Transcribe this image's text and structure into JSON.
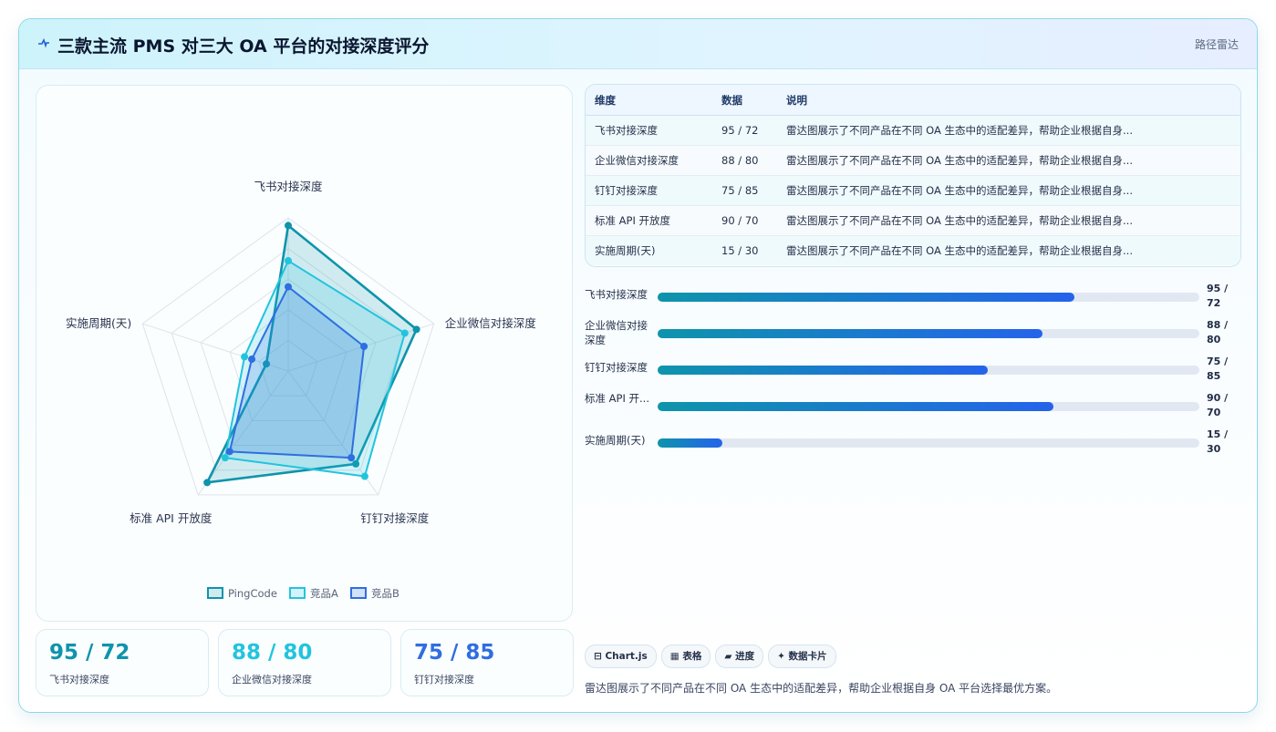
{
  "header": {
    "icon": "pulse-icon",
    "title": "三款主流 PMS 对三大 OA 平台的对接深度评分",
    "tag": "路径雷达"
  },
  "colors": {
    "PingCode": "#0e94ab",
    "competitor_a": "#22c4dd",
    "competitor_b": "#2f6ee0",
    "accent": "#2563eb"
  },
  "chart_data": {
    "type": "radar",
    "axes": [
      "飞书对接深度",
      "企业微信对接深度",
      "钉钉对接深度",
      "标准 API 开放度",
      "实施周期(天)"
    ],
    "series": [
      {
        "name": "PingCode",
        "values": [
          95,
          88,
          75,
          90,
          15
        ]
      },
      {
        "name": "竞品A",
        "values": [
          72,
          80,
          85,
          70,
          30
        ]
      },
      {
        "name": "竞品B",
        "values": [
          55,
          52,
          70,
          65,
          25
        ]
      }
    ],
    "range": [
      0,
      100
    ],
    "rings": 5,
    "legend_position": "bottom"
  },
  "stats": [
    {
      "value": "95 / 72",
      "label": "飞书对接深度"
    },
    {
      "value": "88 / 80",
      "label": "企业微信对接深度"
    },
    {
      "value": "75 / 85",
      "label": "钉钉对接深度"
    }
  ],
  "table": {
    "headers": [
      "维度",
      "数据",
      "说明"
    ],
    "rows": [
      [
        "飞书对接深度",
        "95 / 72",
        "雷达图展示了不同产品在不同 OA 生态中的适配差异，帮助企业根据自身..."
      ],
      [
        "企业微信对接深度",
        "88 / 80",
        "雷达图展示了不同产品在不同 OA 生态中的适配差异，帮助企业根据自身..."
      ],
      [
        "钉钉对接深度",
        "75 / 85",
        "雷达图展示了不同产品在不同 OA 生态中的适配差异，帮助企业根据自身..."
      ],
      [
        "标准 API 开放度",
        "90 / 70",
        "雷达图展示了不同产品在不同 OA 生态中的适配差异，帮助企业根据自身..."
      ],
      [
        "实施周期(天)",
        "15 / 30",
        "雷达图展示了不同产品在不同 OA 生态中的适配差异，帮助企业根据自身..."
      ]
    ]
  },
  "bars": [
    {
      "label": "飞书对接深度",
      "value": "95 / 72",
      "fill": 0.77
    },
    {
      "label": "企业微信对接深度",
      "value": "88 / 80",
      "fill": 0.71
    },
    {
      "label": "钉钉对接深度",
      "value": "75 / 85",
      "fill": 0.61
    },
    {
      "label": "标准 API 开...",
      "value": "90 / 70",
      "fill": 0.73
    },
    {
      "label": "实施周期(天)",
      "value": "15 / 30",
      "fill": 0.12
    }
  ],
  "chips": [
    "⊟ Chart.js",
    "▦ 表格",
    "▰ 进度",
    "✦ 数据卡片"
  ],
  "footer_note": "雷达图展示了不同产品在不同 OA 生态中的适配差异，帮助企业根据自身 OA 平台选择最优方案。"
}
